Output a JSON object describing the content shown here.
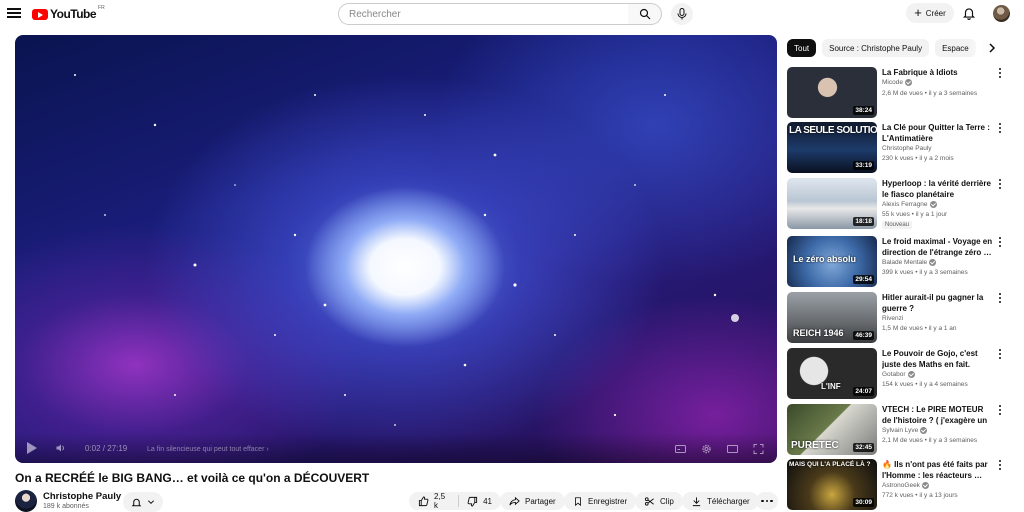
{
  "header": {
    "logo_text": "YouTube",
    "country_code": "FR",
    "search_placeholder": "Rechercher",
    "create_label": "Créer"
  },
  "player": {
    "time": "0:02 / 27:19",
    "chapter": "La fin silencieuse qui peut tout effacer",
    "chapter_arrow": "›"
  },
  "video": {
    "title": "On a RECRÉÉ le BIG BANG… et voilà ce qu'on a DÉCOUVERT",
    "channel": "Christophe Pauly",
    "subscribers": "189 k abonnés",
    "likes": "2,5 k",
    "dislikes": "41",
    "share_label": "Partager",
    "save_label": "Enregistrer",
    "clip_label": "Clip",
    "download_label": "Télécharger"
  },
  "chips": [
    "Tout",
    "Source : Christophe Pauly",
    "Espace",
    "A"
  ],
  "recommendations": [
    {
      "title": "La Fabrique à Idiots",
      "channel": "Micode",
      "verified": true,
      "meta": "2,6 M de vues • il y a 3 semaines",
      "duration": "38:24",
      "badge": "",
      "thumb_text": ""
    },
    {
      "title": "La Clé pour Quitter la Terre : L'Antimatière",
      "channel": "Christophe Pauly",
      "verified": false,
      "meta": "230 k vues • il y a 2 mois",
      "duration": "33:19",
      "badge": "",
      "thumb_text": "LA SEULE SOLUTION"
    },
    {
      "title": "Hyperloop : la vérité derrière le fiasco planétaire",
      "channel": "Alexis Ferragne",
      "verified": true,
      "meta": "55 k vues • il y a 1 jour",
      "duration": "18:18",
      "badge": "Nouveau",
      "thumb_text": ""
    },
    {
      "title": "Le froid maximal - Voyage en direction de l'étrange zéro …",
      "channel": "Balade Mentale",
      "verified": true,
      "meta": "399 k vues • il y a 3 semaines",
      "duration": "29:54",
      "badge": "",
      "thumb_text": "Le zéro absolu"
    },
    {
      "title": "Hitler aurait-il pu gagner la guerre ?",
      "channel": "Rivenzi",
      "verified": false,
      "meta": "1,5 M de vues • il y a 1 an",
      "duration": "46:39",
      "badge": "",
      "thumb_text": "REICH 1946"
    },
    {
      "title": "Le Pouvoir de Gojo, c'est juste des Maths en fait.",
      "channel": "Gotabor",
      "verified": true,
      "meta": "154 k vues • il y a 4 semaines",
      "duration": "24:07",
      "badge": "",
      "thumb_text": "L'INF"
    },
    {
      "title": "VTECH : Le PIRE MOTEUR de l'histoire ? ( j'exagère un peu …",
      "channel": "Sylvain Lyve",
      "verified": true,
      "meta": "2,1 M de vues • il y a 3 semaines",
      "duration": "32:45",
      "badge": "",
      "thumb_text": "PURETEC"
    },
    {
      "title": "🔥 Ils n'ont pas été faits par l'Homme : les réacteurs …",
      "channel": "AstronoGeek",
      "verified": true,
      "meta": "772 k vues • il y a 13 jours",
      "duration": "30:09",
      "badge": "",
      "thumb_text": "MAIS QUI L'A PLACÉ LÀ ?"
    }
  ]
}
